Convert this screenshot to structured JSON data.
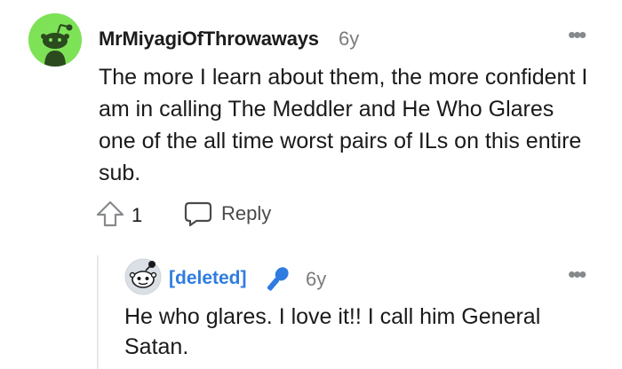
{
  "comment": {
    "author": "MrMiyagiOfThrowaways",
    "age": "6y",
    "text": "The more I learn about them, the more confident I am in calling The Meddler and He Who Glares one of the all time worst pairs of ILs on this entire sub.",
    "score": "1",
    "reply_label": "Reply",
    "more_label": "•••",
    "avatar_color": "#7ee257"
  },
  "reply": {
    "author": "[deleted]",
    "age": "6y",
    "text": "He who glares. I love it!! I call him General Satan.",
    "more_label": "•••",
    "author_color": "#2f7ce0",
    "flair_icon": "microphone-icon"
  }
}
